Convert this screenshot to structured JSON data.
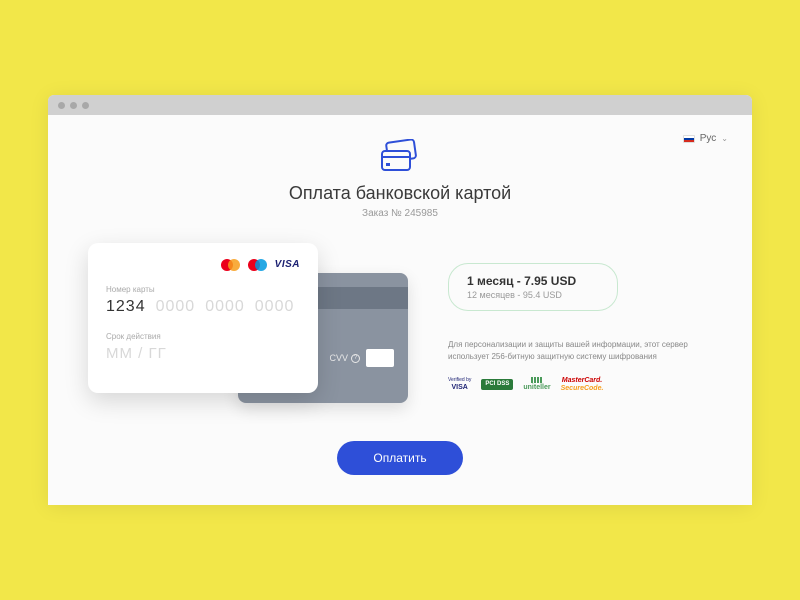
{
  "lang": {
    "label": "Рус"
  },
  "header": {
    "title": "Оплата банковской картой",
    "order": "Заказ № 245985"
  },
  "card": {
    "number_label": "Номер карты",
    "number_filled": "1234",
    "number_placeholder": "0000",
    "expiry_label": "Срок действия",
    "expiry_placeholder": "ММ / ГГ",
    "cvv_label": "CVV",
    "brands": {
      "visa": "VISA"
    }
  },
  "plan": {
    "primary": "1 месяц - 7.95 USD",
    "secondary": "12 месяцев - 95.4 USD"
  },
  "security_text": "Для персонализации и защиты вашей информации, этот сервер использует 256-битную защитную систему шифрования",
  "badges": {
    "verified_by": "Verified by",
    "visa": "VISA",
    "pci": "PCI DSS",
    "uniteller": "uniteller",
    "mc1": "MasterCard.",
    "mc2": "SecureCode."
  },
  "pay_button": "Оплатить"
}
